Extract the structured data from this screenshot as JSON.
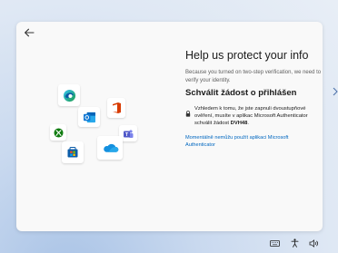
{
  "dialog": {
    "title": "Help us protect your info",
    "description": "Because you turned on two-step verification, we need to verify your identity.",
    "subtitle": "Schválit žádost o přihlášen",
    "notice_prefix": "Vzhledem k tomu, že jste zapnuli dvoustupňové ověření, musíte v aplikac Microsoft Authenticator schválit žádost",
    "code": "DVH48",
    "notice_suffix": ".",
    "alt_link": "Momentálně nemůžu použít aplikaci Microsoft Authenticator"
  },
  "icons": [
    "edge-icon",
    "outlook-icon",
    "office-icon",
    "xbox-icon",
    "teams-icon",
    "store-icon",
    "onedrive-icon"
  ],
  "taskbar_icons": [
    "keyboard-icon",
    "accessibility-icon",
    "volume-icon"
  ],
  "colors": {
    "link": "#0067c0",
    "window_bg": "#f9f9f9"
  }
}
